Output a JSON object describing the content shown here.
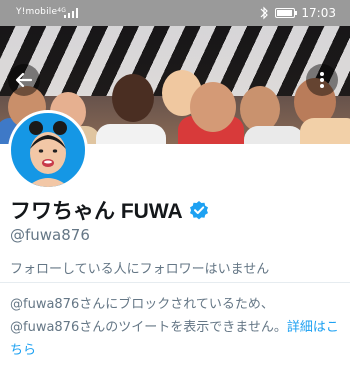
{
  "status_bar": {
    "carrier": "Y!mobile",
    "network_type": "4G",
    "time": "17:03",
    "battery_level": 0.8
  },
  "header": {
    "back_icon": "arrow-left-icon",
    "more_icon": "more-vertical-icon"
  },
  "profile": {
    "display_name": "フワちゃん FUWA",
    "verified": true,
    "handle": "@fuwa876",
    "followers_note": "フォローしている人にフォロワーはいません",
    "blocked_line1": "@fuwa876さんにブロックされているため、",
    "blocked_line2": "@fuwa876さんのツイートを表示できません。",
    "details_link": "詳細はこちら"
  },
  "colors": {
    "accent": "#1da1f2",
    "text_primary": "#14171a",
    "text_secondary": "#657786",
    "status_bar": "#9a9a9a"
  }
}
